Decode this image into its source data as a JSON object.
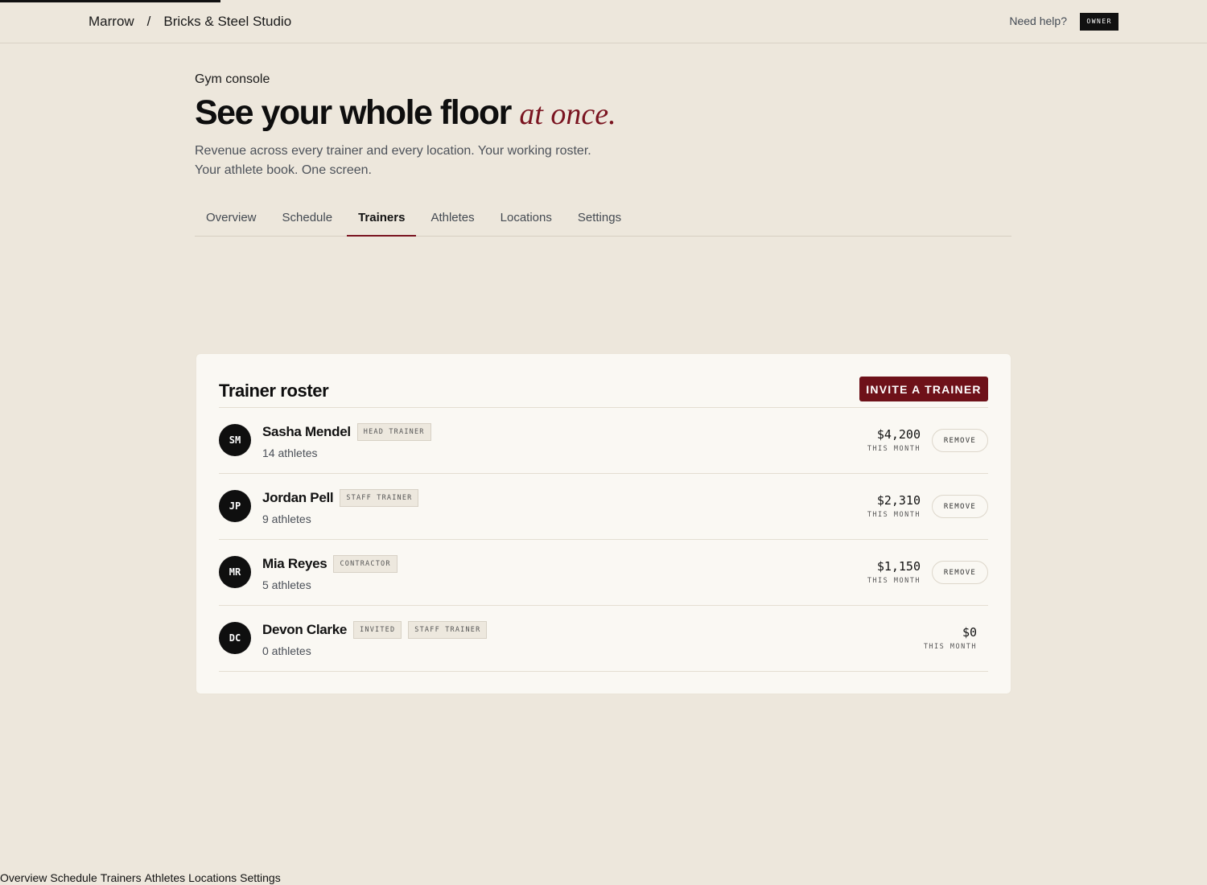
{
  "header": {
    "breadcrumb": [
      "Marrow",
      "Bricks & Steel Studio"
    ],
    "breadcrumb_separator": "/",
    "help_label": "Need help?",
    "role_badge": "OWNER"
  },
  "hero": {
    "eyebrow": "Gym console",
    "headline": "See your whole floor",
    "headline_accent": "at once.",
    "lede": "Revenue across every trainer and every location. Your working roster. Your athlete book. One screen."
  },
  "tabs": [
    {
      "label": "Overview",
      "active": false
    },
    {
      "label": "Schedule",
      "active": false
    },
    {
      "label": "Trainers",
      "active": true
    },
    {
      "label": "Athletes",
      "active": false
    },
    {
      "label": "Locations",
      "active": false
    },
    {
      "label": "Settings",
      "active": false
    }
  ],
  "roster": {
    "title": "Trainer roster",
    "invite_label": "INVITE A TRAINER",
    "remove_label": "REMOVE",
    "period_label": "THIS MONTH",
    "trainers": [
      {
        "initials": "SM",
        "name": "Sasha Mendel",
        "tags": [
          "HEAD TRAINER"
        ],
        "athletes": "14 athletes",
        "revenue": "$4,200",
        "removable": true
      },
      {
        "initials": "JP",
        "name": "Jordan Pell",
        "tags": [
          "STAFF TRAINER"
        ],
        "athletes": "9 athletes",
        "revenue": "$2,310",
        "removable": true
      },
      {
        "initials": "MR",
        "name": "Mia Reyes",
        "tags": [
          "CONTRACTOR"
        ],
        "athletes": "5 athletes",
        "revenue": "$1,150",
        "removable": true
      },
      {
        "initials": "DC",
        "name": "Devon Clarke",
        "tags": [
          "INVITED",
          "STAFF TRAINER"
        ],
        "athletes": "0 athletes",
        "revenue": "$0",
        "removable": false
      }
    ]
  },
  "footer_nav": [
    "Overview",
    "Schedule",
    "Trainers",
    "Athletes",
    "Locations",
    "Settings"
  ],
  "colors": {
    "background": "#ede7dc",
    "card": "#faf8f3",
    "accent": "#7a1420",
    "primary_button": "#6e1119",
    "ink": "#111111"
  }
}
